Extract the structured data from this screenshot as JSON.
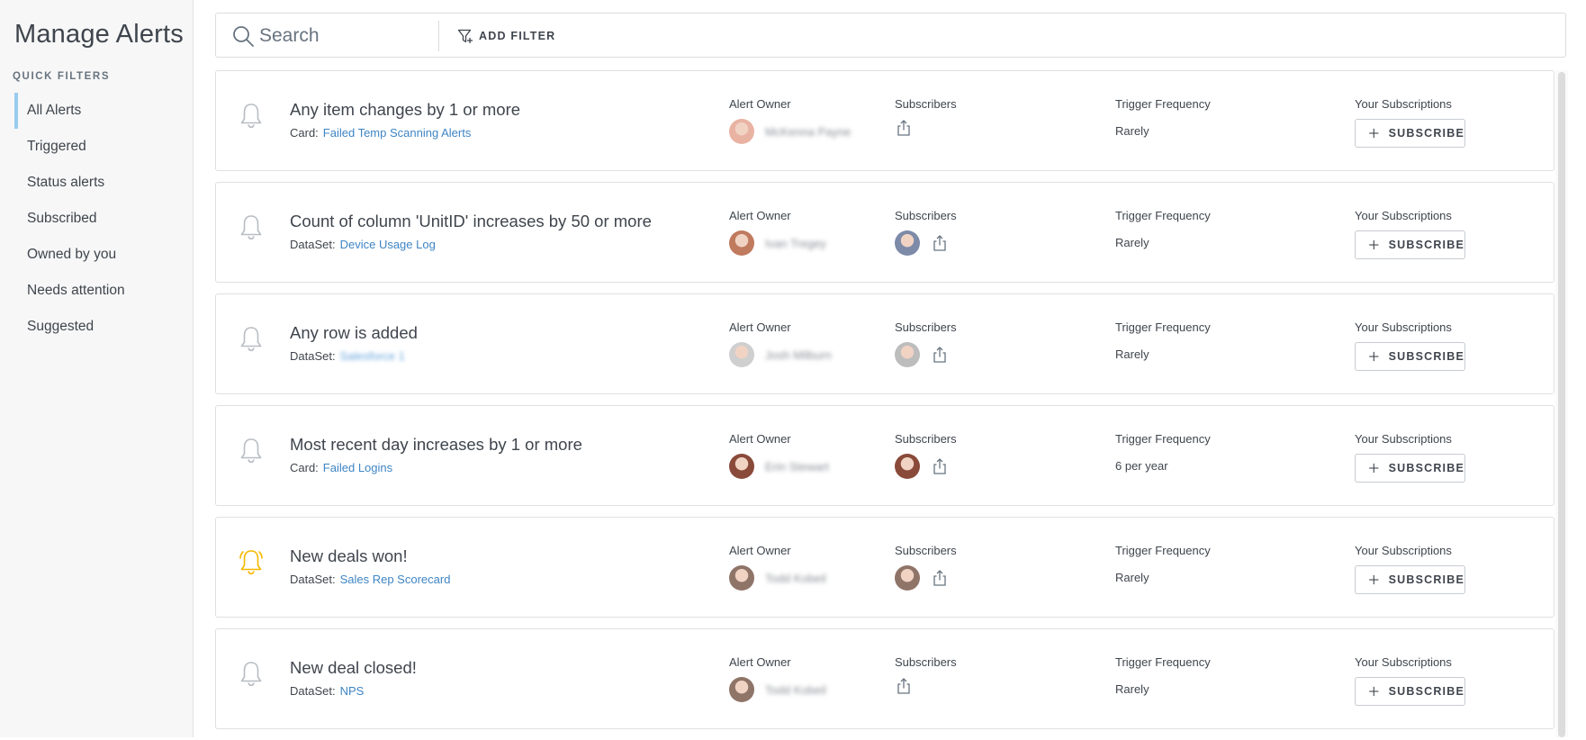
{
  "sidebar": {
    "title": "Manage Alerts",
    "quick_filters_label": "QUICK FILTERS",
    "items": [
      {
        "label": "All Alerts",
        "active": true
      },
      {
        "label": "Triggered"
      },
      {
        "label": "Status alerts"
      },
      {
        "label": "Subscribed"
      },
      {
        "label": "Owned by you"
      },
      {
        "label": "Needs attention"
      },
      {
        "label": "Suggested"
      }
    ]
  },
  "search": {
    "placeholder": "Search",
    "value": "",
    "add_filter_label": "ADD FILTER"
  },
  "columns": {
    "owner": "Alert Owner",
    "subscribers": "Subscribers",
    "frequency": "Trigger Frequency",
    "subscriptions": "Your Subscriptions"
  },
  "subscribe_label": "SUBSCRIBE",
  "colors": {
    "link": "#3f85c4",
    "active_bell": "#f5b800",
    "inactive_bell": "#b8bcc1",
    "active_filter_bar": "#99ccee"
  },
  "alerts": [
    {
      "title": "Any item changes by 1 or more",
      "source_type": "Card:",
      "source_name": "Failed Temp Scanning Alerts",
      "owner_name": "McKenna Payne",
      "owner_avatar": "#e9b3a3",
      "subscriber_avatar": "",
      "frequency": "Rarely",
      "bell": "inactive-bell-icon"
    },
    {
      "title": "Count of column 'UnitID' increases by 50 or more",
      "source_type": "DataSet:",
      "source_name": "Device Usage Log",
      "owner_name": "Ivan Tregey",
      "owner_avatar": "#c07a5e",
      "subscriber_avatar": "#7d8aa8",
      "frequency": "Rarely",
      "bell": "inactive-bell-icon"
    },
    {
      "title": "Any row is added",
      "source_type": "DataSet:",
      "source_name": "Salesforce 1",
      "owner_name": "Josh Milburn",
      "owner_avatar": "#cfcfcf",
      "subscriber_avatar": "#bdbdbd",
      "frequency": "Rarely",
      "bell": "inactive-bell-icon"
    },
    {
      "title": "Most recent day increases by 1 or more",
      "source_type": "Card:",
      "source_name": "Failed Logins",
      "owner_name": "Erin Stewart",
      "owner_avatar": "#8a4a3a",
      "subscriber_avatar": "#8a4a3a",
      "frequency": "6 per year",
      "bell": "inactive-bell-icon"
    },
    {
      "title": "New deals won!",
      "source_type": "DataSet:",
      "source_name": "Sales Rep Scorecard",
      "owner_name": "Todd Kobeil",
      "owner_avatar": "#8f7468",
      "subscriber_avatar": "#8f7468",
      "frequency": "Rarely",
      "bell": "active-bell-icon"
    },
    {
      "title": "New deal closed!",
      "source_type": "DataSet:",
      "source_name": "NPS",
      "owner_name": "Todd Kobeil",
      "owner_avatar": "#8f7468",
      "subscriber_avatar": "",
      "frequency": "Rarely",
      "bell": "inactive-bell-icon"
    }
  ]
}
